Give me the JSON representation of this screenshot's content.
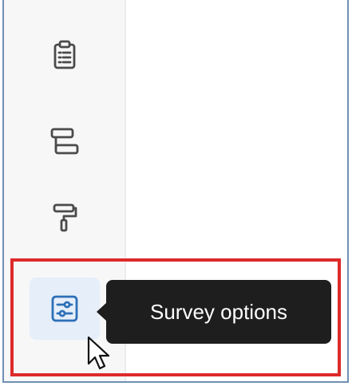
{
  "sidebar": {
    "items": [
      {
        "icon": "clipboard-icon",
        "active": false
      },
      {
        "icon": "layout-icon",
        "active": false
      },
      {
        "icon": "paint-roller-icon",
        "active": false
      },
      {
        "icon": "sliders-icon",
        "active": true
      }
    ]
  },
  "tooltip": {
    "text": "Survey options"
  },
  "colors": {
    "active_bg": "#e5eef9",
    "active_icon": "#2d6fb8",
    "icon": "#4a4a4a",
    "tooltip_bg": "#1e1e1e",
    "highlight": "#dd2a2a",
    "frame_border": "#6f8fb5"
  }
}
